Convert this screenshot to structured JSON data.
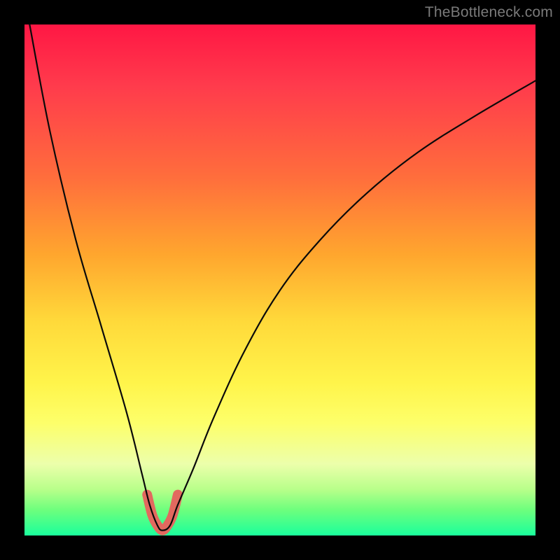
{
  "watermark": "TheBottleneck.com",
  "chart_data": {
    "type": "line",
    "title": "",
    "xlabel": "",
    "ylabel": "",
    "xlim": [
      0,
      100
    ],
    "ylim": [
      0,
      100
    ],
    "grid": false,
    "legend": false,
    "series": [
      {
        "name": "bottleneck-curve",
        "color": "#000000",
        "x": [
          1,
          5,
          10,
          15,
          20,
          23,
          24.5,
          26,
          27,
          28.5,
          30,
          33,
          37,
          43,
          50,
          58,
          67,
          77,
          88,
          100
        ],
        "values": [
          100,
          79,
          58,
          41,
          24,
          12,
          6,
          2,
          1,
          2,
          6,
          13,
          23,
          36,
          48,
          58,
          67,
          75,
          82,
          89
        ]
      }
    ],
    "highlight_region": {
      "name": "optimal-zone",
      "color": "#e2695f",
      "x": [
        24,
        25,
        26,
        27,
        28,
        29,
        30
      ],
      "values": [
        8,
        4,
        2,
        1,
        2,
        4,
        8
      ]
    },
    "minimum_point": {
      "x": 27,
      "value": 1
    }
  }
}
